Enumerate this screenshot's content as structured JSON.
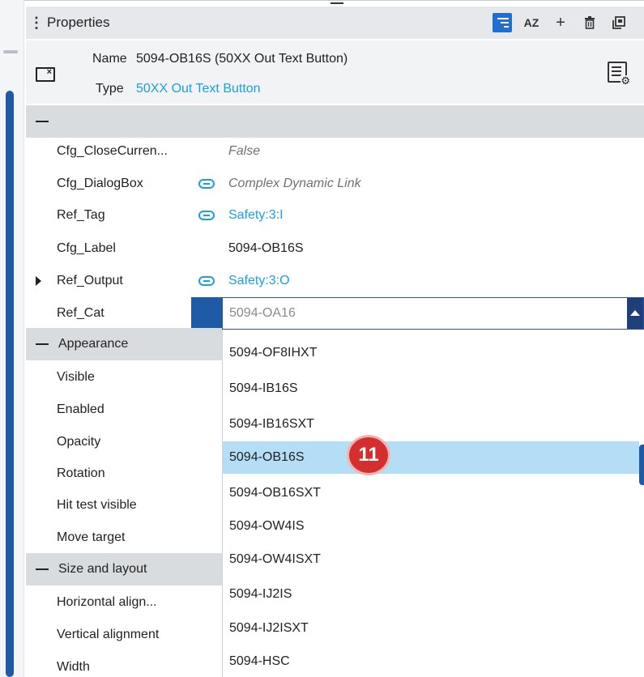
{
  "panel": {
    "title": "Properties",
    "tools": [
      "filter-icon",
      "sort-az-icon",
      "plus-icon",
      "trash-icon",
      "popout-icon"
    ],
    "sort_label": "AZ"
  },
  "object": {
    "name_label": "Name",
    "name_value": "5094-OB16S (50XX Out Text Button)",
    "type_label": "Type",
    "type_value": "50XX Out Text Button"
  },
  "properties": [
    {
      "name": "Cfg_CloseCurren...",
      "value": "False",
      "style": "italic",
      "linked": false
    },
    {
      "name": "Cfg_DialogBox",
      "value": "Complex Dynamic Link",
      "style": "italic",
      "linked": true
    },
    {
      "name": "Ref_Tag",
      "value": "Safety:3:I",
      "style": "link",
      "linked": true
    },
    {
      "name": "Cfg_Label",
      "value": "5094-OB16S",
      "style": "plain",
      "linked": false
    },
    {
      "name": "Ref_Output",
      "value": "Safety:3:O",
      "style": "link",
      "linked": true,
      "expandable": true
    },
    {
      "name": "Ref_Cat",
      "value": "",
      "style": "plain",
      "linked": false
    }
  ],
  "ref_cat_input": {
    "value": "5094-OA16"
  },
  "sections": {
    "appearance": {
      "label": "Appearance",
      "items": [
        "Visible",
        "Enabled",
        "Opacity",
        "Rotation",
        "Hit test visible",
        "Move target"
      ]
    },
    "size_layout": {
      "label": "Size and layout",
      "items": [
        "Horizontal align...",
        "Vertical alignment",
        "Width"
      ]
    }
  },
  "dropdown": {
    "options": [
      "5094-OF8IHXT",
      "5094-IB16S",
      "5094-IB16SXT",
      "5094-OB16S",
      "5094-OB16SXT",
      "5094-OW4IS",
      "5094-OW4ISXT",
      "5094-IJ2IS",
      "5094-IJ2ISXT",
      "5094-HSC"
    ],
    "selected_index": 3
  },
  "step_badge": "11",
  "colors": {
    "accent": "#1f5aa6",
    "link": "#1aa0e0",
    "selection": "#b3def5",
    "badge": "#d32f2f"
  }
}
